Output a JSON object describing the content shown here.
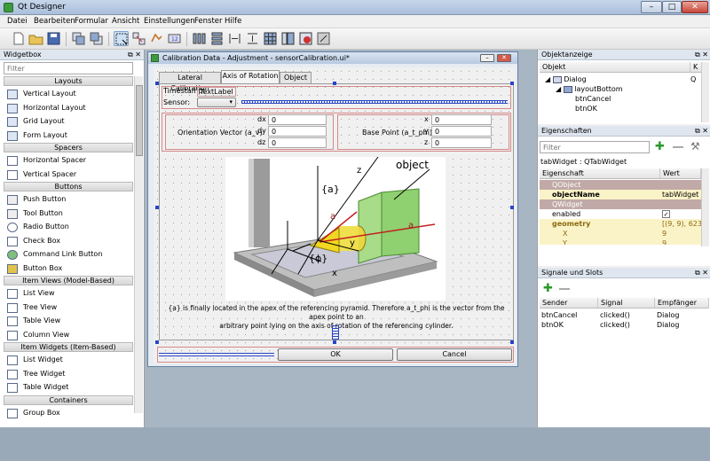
{
  "window": {
    "title": "Qt Designer",
    "min": "–",
    "max": "□",
    "close": "✕"
  },
  "menu": [
    "Datei",
    "Bearbeiten",
    "Formular",
    "Ansicht",
    "Einstellungen",
    "Fenster",
    "Hilfe"
  ],
  "widgetbox": {
    "title": "Widgetbox",
    "filter_placeholder": "Filter",
    "layouts_cat": "Layouts",
    "layouts": [
      "Vertical Layout",
      "Horizontal Layout",
      "Grid Layout",
      "Form Layout"
    ],
    "spacers_cat": "Spacers",
    "spacers": [
      "Horizontal Spacer",
      "Vertical Spacer"
    ],
    "buttons_cat": "Buttons",
    "buttons": [
      "Push Button",
      "Tool Button",
      "Radio Button",
      "Check Box",
      "Command Link Button",
      "Button Box"
    ],
    "itemviews_cat": "Item Views (Model-Based)",
    "itemviews": [
      "List View",
      "Tree View",
      "Table View",
      "Column View"
    ],
    "itemwidgets_cat": "Item Widgets (Item-Based)",
    "itemwidgets": [
      "List Widget",
      "Tree Widget",
      "Table Widget"
    ],
    "containers_cat": "Containers",
    "containers": [
      "Group Box"
    ]
  },
  "form": {
    "title": "Calibration Data - Adjustment - sensorCalibration.ui*",
    "tabs": [
      "Lateral Calibration",
      "Axis of Rotation",
      "Object"
    ],
    "timestamp_label": "Timestamp:",
    "timestamp_value": "TextLabel",
    "sensor_label": "Sensor:",
    "orientation_label": "Orientation Vector (a_v):",
    "dx_label": "dx",
    "dx_value": "0",
    "dy_label": "dy",
    "dy_value": "0",
    "dz_label": "dz",
    "dz_value": "0",
    "base_label": "Base Point (a_t_phi):",
    "x_label": "x",
    "x_value": "0",
    "y_label": "y",
    "y_value": "0",
    "z_label": "z",
    "z_value": "0",
    "image_label_object": "object",
    "image_label_a": "{a}",
    "image_label_phi": "{ϕ}",
    "image_label_z": "z",
    "image_label_x": "x",
    "image_label_y": "y",
    "image_label_av": "a",
    "image_label_at": "a",
    "caption_line1": "{a} is finally located in the apex of the referencing pyramid. Therefore a_t_phi is the vector from the apex point to an",
    "caption_line2": "arbitrary point lying on the axis of rotation of the referencing cylinder.",
    "ok_label": "OK",
    "cancel_label": "Cancel"
  },
  "object_inspector": {
    "title": "Objektanzeige",
    "col_object": "Objekt",
    "col_class": "K",
    "items": [
      "Dialog",
      "layoutBottom",
      "btnCancel",
      "btnOK"
    ],
    "class_first": "Q"
  },
  "property_editor": {
    "title": "Eigenschaften",
    "filter_placeholder": "Filter",
    "subtitle": "tabWidget : QTabWidget",
    "col_property": "Eigenschaft",
    "col_value": "Wert",
    "rows": [
      {
        "name": "QObject",
        "value": ""
      },
      {
        "name": "objectName",
        "value": "tabWidget"
      },
      {
        "name": "QWidget",
        "value": ""
      },
      {
        "name": "enabled",
        "value": "✓"
      },
      {
        "name": "geometry",
        "value": "[(9, 9), 623"
      },
      {
        "name": "X",
        "value": "9"
      },
      {
        "name": "Y",
        "value": "9"
      }
    ]
  },
  "signals": {
    "title": "Signale und Slots",
    "col_sender": "Sender",
    "col_signal": "Signal",
    "col_receiver": "Empfänger",
    "rows": [
      {
        "sender": "btnCancel",
        "signal": "clicked()",
        "receiver": "Dialog"
      },
      {
        "sender": "btnOK",
        "signal": "clicked()",
        "receiver": "Dialog"
      }
    ]
  }
}
